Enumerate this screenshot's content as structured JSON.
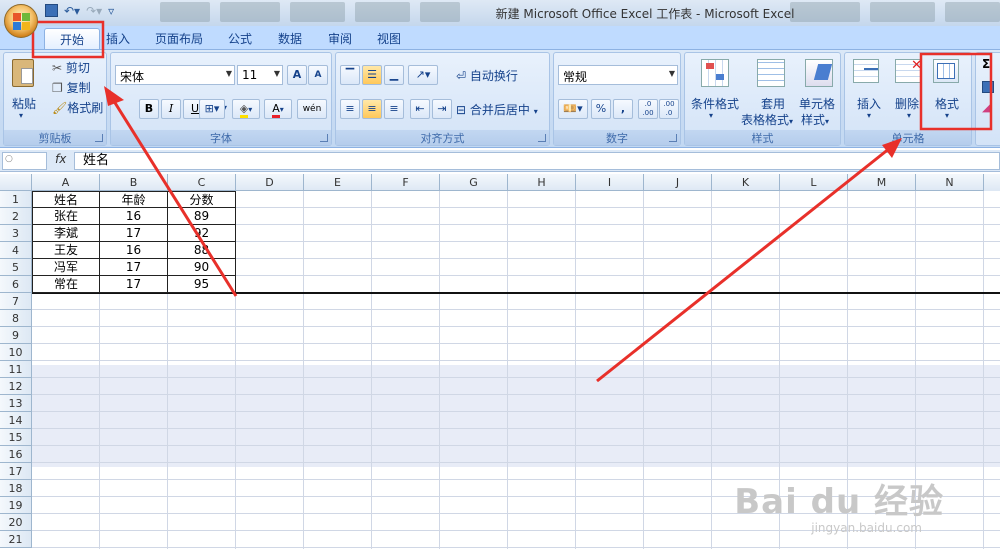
{
  "window": {
    "title": "新建 Microsoft Office Excel 工作表 - Microsoft Excel"
  },
  "tabs": [
    "开始",
    "插入",
    "页面布局",
    "公式",
    "数据",
    "审阅",
    "视图"
  ],
  "clipboard": {
    "paste": "粘贴",
    "cut": "剪切",
    "copy": "复制",
    "format_painter": "格式刷",
    "label": "剪贴板"
  },
  "font": {
    "name": "宋体",
    "size": "11",
    "bold": "B",
    "italic": "I",
    "underline": "U",
    "label": "字体",
    "grow": "A",
    "shrink": "A",
    "color_a": "A",
    "wen": "wén"
  },
  "alignment": {
    "wrap": "自动换行",
    "merge": "合并后居中",
    "label": "对齐方式"
  },
  "number": {
    "format": "常规",
    "percent": "%",
    "comma": ",",
    "label": "数字",
    "inc": ".0 .00",
    "dec": ".00 .0"
  },
  "styles": {
    "conditional": "条件格式",
    "table1": "套用",
    "table2": "表格格式",
    "cell1": "单元格",
    "cell2": "样式",
    "label": "样式"
  },
  "cells": {
    "insert": "插入",
    "delete": "删除",
    "format": "格式",
    "label": "单元格"
  },
  "editing": {
    "sigma": "Σ"
  },
  "formula_bar": {
    "fx": "fx",
    "value": "姓名"
  },
  "columns": [
    "A",
    "B",
    "C",
    "D",
    "E",
    "F",
    "G",
    "H",
    "I",
    "J",
    "K",
    "L",
    "M",
    "N"
  ],
  "rows": [
    "1",
    "2",
    "3",
    "4",
    "5",
    "6",
    "7",
    "8",
    "9",
    "10",
    "11",
    "12",
    "13",
    "14",
    "15",
    "16",
    "17",
    "18",
    "19",
    "20",
    "21"
  ],
  "table": {
    "header": [
      "姓名",
      "年龄",
      "分数"
    ],
    "rows": [
      [
        "张在",
        "16",
        "89"
      ],
      [
        "李斌",
        "17",
        "92"
      ],
      [
        "王友",
        "16",
        "88"
      ],
      [
        "冯军",
        "17",
        "90"
      ],
      [
        "常在",
        "17",
        "95"
      ]
    ]
  },
  "watermark": {
    "main": "Bai du 经验",
    "sub": "jingyan.baidu.com"
  },
  "colors": {
    "annotation": "#e8302a",
    "ribbon": "#c9dcf3",
    "header": "#dde8f4"
  }
}
